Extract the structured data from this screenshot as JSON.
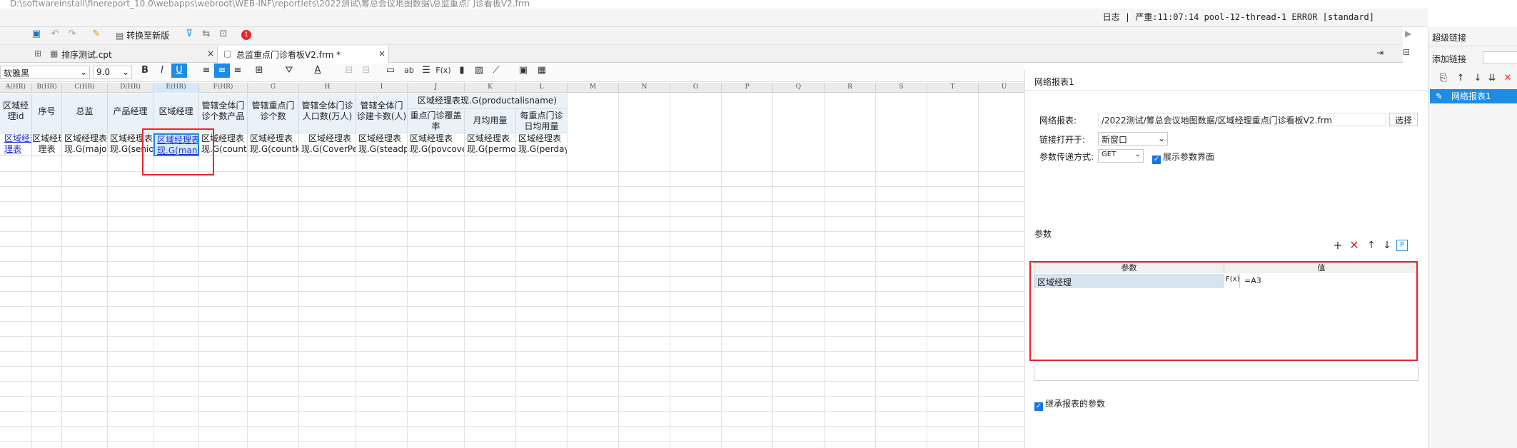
{
  "window": {
    "title": "D:\\softwareinstall\\finereport_10.0\\webapps\\webroot\\WEB-INF\\reportlets\\2022测试\\筹总会议地图数据\\总监重点门诊看板V2.frm"
  },
  "log": {
    "label": "日志",
    "status": "严重:11:07:14 pool-12-thread-1 ERROR [standard]"
  },
  "toolbar": {
    "convert_label": "转换至新版",
    "notice_count": "1"
  },
  "tabs": [
    {
      "label": "排序测试.cpt",
      "close": "×"
    },
    {
      "label": "总监重点门诊看板V2.frm *",
      "close": "×"
    }
  ],
  "format": {
    "font_name": "软雅黑",
    "font_size": "9.0",
    "colors": {
      "accent": "#1c8ce6",
      "selection": "#d6e8f8",
      "alert": "#e8262b"
    }
  },
  "columns": [
    "A(HR)",
    "B(HR)",
    "C(HR)",
    "D(HR)",
    "E(HR)",
    "F(HR)",
    "G",
    "H",
    "I",
    "J",
    "K",
    "L",
    "M",
    "N",
    "O",
    "P",
    "Q",
    "R",
    "S",
    "T",
    "U"
  ],
  "header_row": [
    "区域经理id",
    "序号",
    "总监",
    "产品经理",
    "区域经理",
    "管辖全体门诊个数产品",
    "管辖重点门诊个数",
    "管辖全体门诊人口数(万人)",
    "管辖全体门诊建卡数(人)",
    "区域经理表现.G(productalisname)",
    "",
    "每重点门诊日均用量"
  ],
  "j_sub": "重点门诊覆盖率",
  "k_sub": "月均用量",
  "data_row": [
    "区域经理表",
    "区域经理表",
    "区域经理表",
    "区域经理表",
    "区域经理表",
    "区域经理表",
    "区域经理表",
    "区域经理表",
    "区域经理表",
    "区域经理表",
    "区域经理表",
    "区域经理表"
  ],
  "data_row2": [
    "理表",
    "现.G(major",
    "现.G(senio",
    "现.G(mana",
    "现.G(count",
    "现.G(countk",
    "现.G(CoverPe",
    "现.G(steadp",
    "现.G(povcove",
    "现.G(permo",
    "现.G(perday",
    ""
  ],
  "hyperlink_panel": {
    "title": "网络报表1",
    "report_label": "网络报表:",
    "report_path": "/2022测试/筹总会议地图数据/区域经理重点门诊看板V2.frm",
    "select_button": "选择",
    "open_label": "链接打开于:",
    "open_value": "新窗口",
    "method_label": "参数传递方式:",
    "method_value": "GET",
    "show_params_label": "展示参数界面",
    "params_section": "参数",
    "param_col_name": "参数",
    "param_col_value": "值",
    "param_name": "区域经理",
    "param_fx": "F(x)",
    "param_value": "=A3",
    "inherit_label": "继承报表的参数"
  },
  "side": {
    "title": "超级链接",
    "add_label": "添加链接",
    "item_label": "网络报表1"
  }
}
